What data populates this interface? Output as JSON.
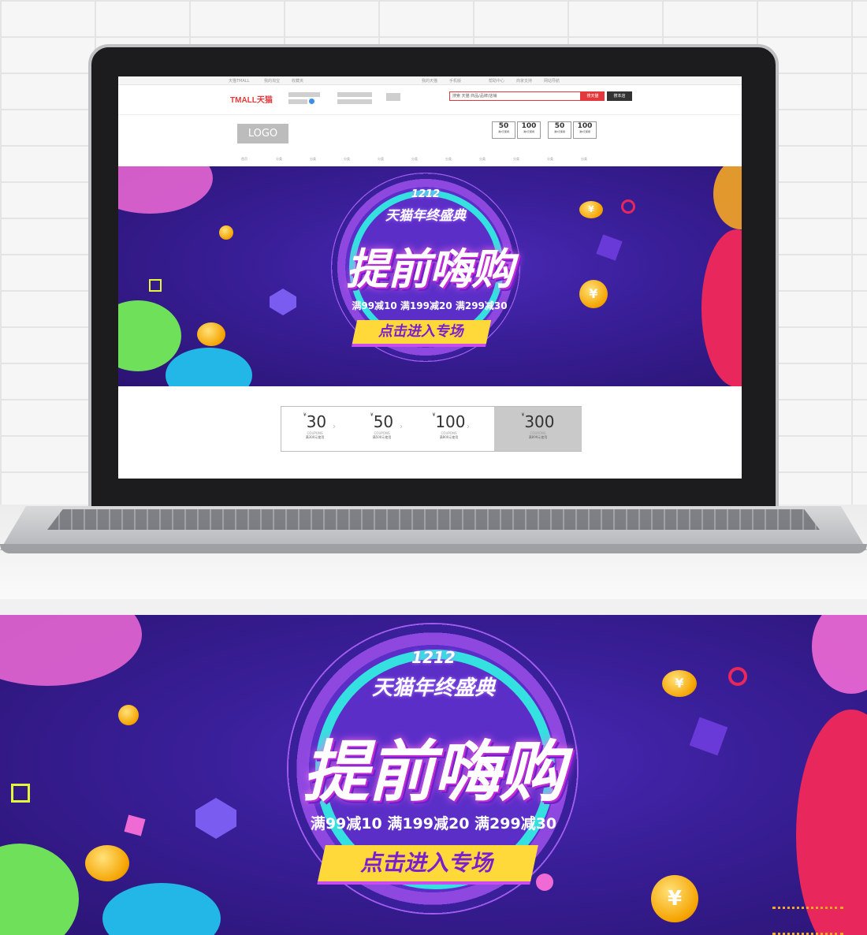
{
  "header": {
    "topbar_links": [
      "天猫TMALL",
      "我的淘宝",
      "收藏夹",
      "我的天猫",
      "手机版",
      "帮助中心",
      "商家支持",
      "网站导航"
    ],
    "brand": "TMALL天猫",
    "search_placeholder": "搜索 天猫 商品/品牌/店铺",
    "search_button": "搜天猫",
    "search_store_button": "搜本店",
    "logo": "LOGO",
    "header_coupons": [
      {
        "value": "50",
        "note": "满X元使用"
      },
      {
        "value": "100",
        "note": "满X元使用"
      },
      {
        "value": "50",
        "note": "满X元使用"
      },
      {
        "value": "100",
        "note": "满X元使用"
      }
    ],
    "nav_items": [
      "首页",
      "分类",
      "分类",
      "分类",
      "分类",
      "分类",
      "分类",
      "分类",
      "分类",
      "分类",
      "分类"
    ]
  },
  "banner": {
    "tag_number": "1212",
    "tag_text": "天猫年终盛典",
    "title": "提前嗨购",
    "promo": "满99减10 满199减20 满299减30",
    "cta": "点击进入专场",
    "coin_symbol": "¥"
  },
  "coupons": [
    {
      "symbol": "¥",
      "amount": "30",
      "label": "COUPONS",
      "desc": "满300元使用",
      "highlight": false
    },
    {
      "symbol": "¥",
      "amount": "50",
      "label": "COUPONS",
      "desc": "满500元使用",
      "highlight": false
    },
    {
      "symbol": "¥",
      "amount": "100",
      "label": "COUPONS",
      "desc": "满800元使用",
      "highlight": false
    },
    {
      "symbol": "¥",
      "amount": "300",
      "label": "COUPONS",
      "desc": "满899元使用",
      "highlight": true
    }
  ],
  "coupon_separator": "›"
}
